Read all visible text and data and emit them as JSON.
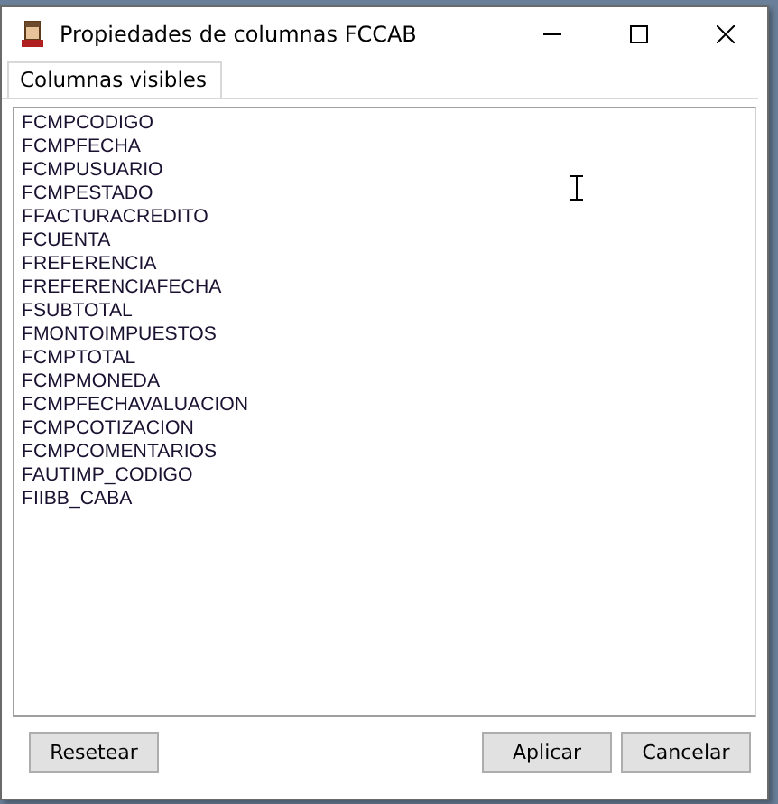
{
  "window": {
    "title": "Propiedades de columnas FCCAB"
  },
  "tabs": [
    {
      "label": "Columnas visibles",
      "selected": true
    }
  ],
  "columns_list": [
    "FCMPCODIGO",
    "FCMPFECHA",
    "FCMPUSUARIO",
    "FCMPESTADO",
    "FFACTURACREDITO",
    "FCUENTA",
    "FREFERENCIA",
    "FREFERENCIAFECHA",
    "FSUBTOTAL",
    "FMONTOIMPUESTOS",
    "FCMPTOTAL",
    "FCMPMONEDA",
    "FCMPFECHAVALUACION",
    "FCMPCOTIZACION",
    "FCMPCOMENTARIOS",
    "FAUTIMP_CODIGO",
    "FIIBB_CABA"
  ],
  "buttons_left": [
    "Resetear"
  ],
  "buttons_right": [
    "Aplicar",
    "Cancelar"
  ]
}
